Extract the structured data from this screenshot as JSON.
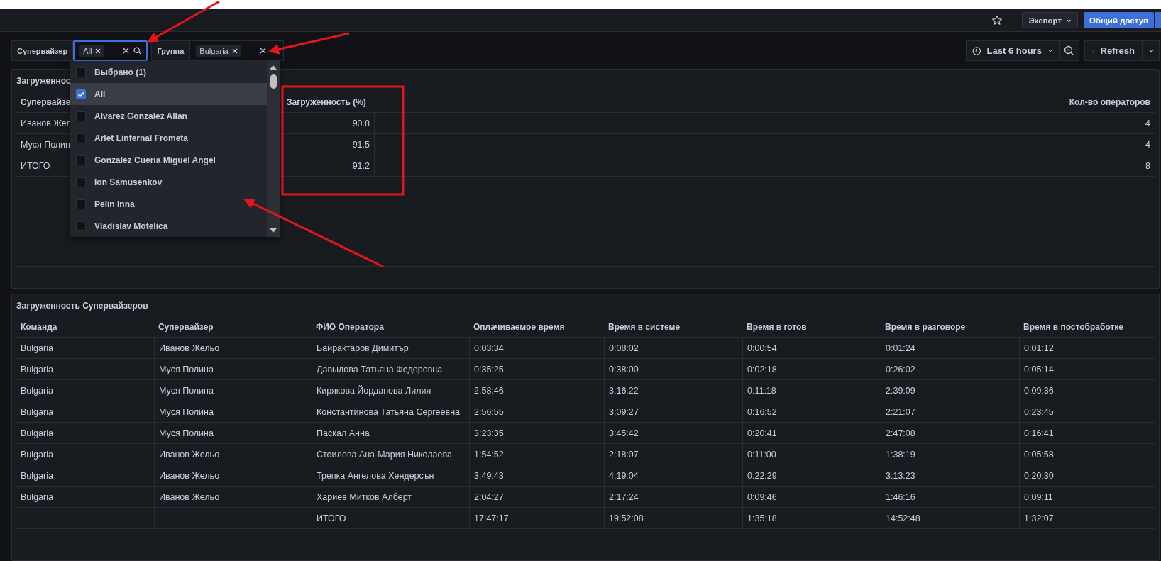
{
  "toolbar": {
    "export_button": "Экспорт",
    "share_button": "Общий доступ"
  },
  "filters": [
    {
      "label": "Супервайзер",
      "chips": [
        "All"
      ],
      "focused": true
    },
    {
      "label": "Группа",
      "chips": [
        "Bulgaria"
      ],
      "focused": false
    }
  ],
  "time_range": {
    "label": "Last 6 hours"
  },
  "refresh_button": "Refresh",
  "dropdown": {
    "items": [
      {
        "label": "Выбрано (1)",
        "checked": false,
        "selected": false
      },
      {
        "label": "All",
        "checked": true,
        "selected": true
      },
      {
        "label": "Alvarez Gonzalez Allan",
        "checked": false,
        "selected": false
      },
      {
        "label": "Arlet Linfernal Frometa",
        "checked": false,
        "selected": false
      },
      {
        "label": "Gonzalez Cueria Miguel Angel",
        "checked": false,
        "selected": false
      },
      {
        "label": "Ion Samusenkov",
        "checked": false,
        "selected": false
      },
      {
        "label": "Pelin Inna",
        "checked": false,
        "selected": false
      },
      {
        "label": "Vladislav Motelica",
        "checked": false,
        "selected": false
      }
    ]
  },
  "summary_panel": {
    "title": "Загруженнос",
    "columns": [
      "Супервайзе",
      "Загруженность (%)",
      "Кол-во операторов"
    ],
    "rows": [
      {
        "supervisor": "Иванов Жел",
        "load": "90.8",
        "operators": "4"
      },
      {
        "supervisor": "Муся Полин",
        "load": "91.5",
        "operators": "4"
      },
      {
        "supervisor": "ИТОГО",
        "load": "91.2",
        "operators": "8"
      }
    ]
  },
  "detail_panel": {
    "title": "Загруженность Супервайзеров",
    "columns": [
      "Команда",
      "Супервайзер",
      "ФИО Оператора",
      "Оплачиваемое время",
      "Время в системе",
      "Время в готов",
      "Время в разговоре",
      "Время в постобработке"
    ],
    "rows": [
      {
        "cells": [
          "Bulgaria",
          "Иванов Жельо",
          "Байрактаров Димитър",
          "0:03:34",
          "0:08:02",
          "0:00:54",
          "0:01:24",
          "0:01:12"
        ]
      },
      {
        "cells": [
          "Bulgaria",
          "Муся Полина",
          "Давыдова Татьяна Федоровна",
          "0:35:25",
          "0:38:00",
          "0:02:18",
          "0:26:02",
          "0:05:14"
        ]
      },
      {
        "cells": [
          "Bulgaria",
          "Муся Полина",
          "Кирякова Йорданова Лилия",
          "2:58:46",
          "3:16:22",
          "0:11:18",
          "2:39:09",
          "0:09:36"
        ]
      },
      {
        "cells": [
          "Bulgaria",
          "Муся Полина",
          "Константинова Татьяна Сергеевна",
          "2:56:55",
          "3:09:27",
          "0:16:52",
          "2:21:07",
          "0:23:45"
        ]
      },
      {
        "cells": [
          "Bulgaria",
          "Муся Полина",
          "Паскал Анна",
          "3:23:35",
          "3:45:42",
          "0:20:41",
          "2:47:08",
          "0:16:41"
        ]
      },
      {
        "cells": [
          "Bulgaria",
          "Иванов Жельо",
          "Стоилова Ана-Мария Николаева",
          "1:54:52",
          "2:18:07",
          "0:11:00",
          "1:38:19",
          "0:05:58"
        ]
      },
      {
        "cells": [
          "Bulgaria",
          "Иванов Жельо",
          "Трепка Ангелова Хендерсън",
          "3:49:43",
          "4:19:04",
          "0:22:29",
          "3:13:23",
          "0:20:30"
        ]
      },
      {
        "cells": [
          "Bulgaria",
          "Иванов Жельо",
          "Хариев Митков Алберт",
          "2:04:27",
          "2:17:24",
          "0:09:46",
          "1:46:16",
          "0:09:11"
        ]
      },
      {
        "cells": [
          "",
          "",
          "ИТОГО",
          "17:47:17",
          "19:52:08",
          "1:35:18",
          "14:52:48",
          "1:32:07"
        ]
      }
    ]
  }
}
